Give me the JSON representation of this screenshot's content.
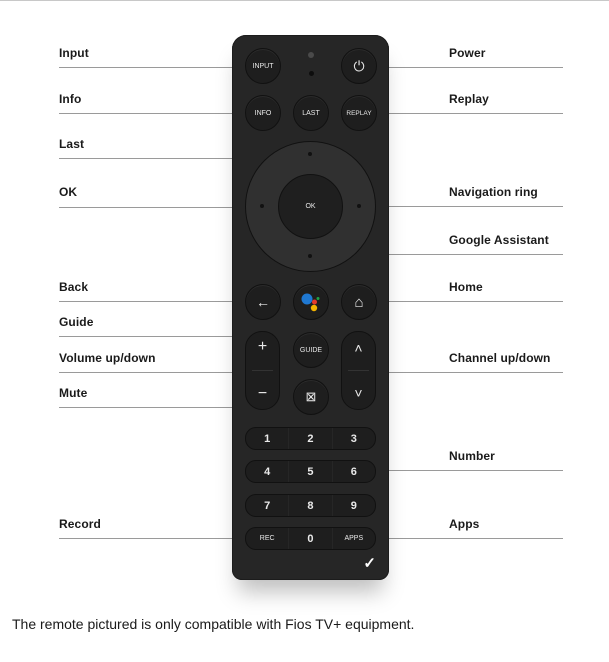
{
  "labels_left": {
    "input": "Input",
    "info": "Info",
    "last": "Last",
    "ok": "OK",
    "back": "Back",
    "guide": "Guide",
    "volume": "Volume up/down",
    "mute": "Mute",
    "record": "Record"
  },
  "labels_right": {
    "power": "Power",
    "replay": "Replay",
    "nav_ring": "Navigation ring",
    "google_assistant": "Google Assistant",
    "home": "Home",
    "channel": "Channel up/down",
    "number": "Number",
    "apps": "Apps"
  },
  "remote": {
    "input_btn": "INPUT",
    "info_btn": "INFO",
    "last_btn": "LAST",
    "replay_btn": "REPLAY",
    "ok_btn": "OK",
    "guide_btn": "GUIDE",
    "power_icon": "⏻",
    "back_icon": "←",
    "home_icon": "⌂",
    "vol_up": "+",
    "vol_down": "−",
    "ch_up": "˄",
    "ch_down": "˅",
    "mute_icon": "⊠",
    "keypad": [
      [
        "1",
        "2",
        "3"
      ],
      [
        "4",
        "5",
        "6"
      ],
      [
        "7",
        "8",
        "9"
      ],
      [
        "REC",
        "0",
        "APPS"
      ]
    ],
    "brand_mark": "✓",
    "assistant_colors": {
      "blue": "#1f78d1",
      "red": "#e53b2c",
      "yellow": "#f4b400",
      "green": "#1ea446"
    }
  },
  "caption": "The remote pictured is only compatible with Fios TV+ equipment."
}
